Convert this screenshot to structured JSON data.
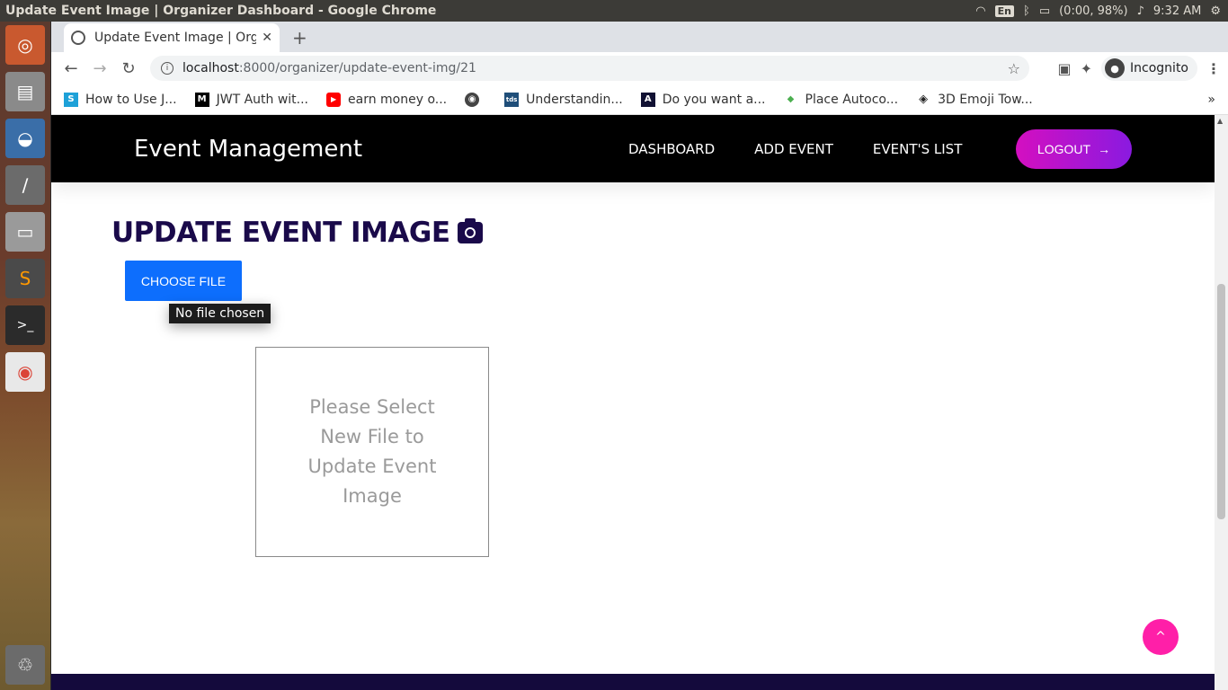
{
  "os": {
    "window_title": "Update Event Image | Organizer Dashboard - Google Chrome",
    "lang": "En",
    "battery": "(0:00, 98%)",
    "time": "9:32 AM"
  },
  "browser": {
    "tab_title": "Update Event Image | Organizer Dashboard",
    "url_host": "localhost",
    "url_path": ":8000/organizer/update-event-img/21",
    "incognito_label": "Incognito",
    "bookmarks": [
      {
        "label": "How to Use J...",
        "icon_color": "#1ea1d8",
        "icon_text": "S"
      },
      {
        "label": "JWT Auth wit...",
        "icon_color": "#000000",
        "icon_text": "M"
      },
      {
        "label": "earn money o...",
        "icon_color": "#ff0000",
        "icon_text": "▶"
      },
      {
        "label": "",
        "icon_color": "#444444",
        "icon_text": "◉"
      },
      {
        "label": "Understandin...",
        "icon_color": "#1f4e79",
        "icon_text": "tds"
      },
      {
        "label": "Do you want a...",
        "icon_color": "#111133",
        "icon_text": "A"
      },
      {
        "label": "Place Autoco...",
        "icon_color": "#4caf50",
        "icon_text": "◆"
      },
      {
        "label": "3D Emoji Tow...",
        "icon_color": "#222222",
        "icon_text": "◈"
      }
    ],
    "more_bookmarks": "»"
  },
  "site": {
    "brand": "Event Management",
    "nav": {
      "dashboard": "DASHBOARD",
      "add_event": "ADD EVENT",
      "events_list": "EVENT'S LIST"
    },
    "logout_label": "LOGOUT",
    "logout_arrow": "→"
  },
  "main": {
    "heading": "UPDATE EVENT IMAGE",
    "choose_file_label": "CHOOSE FILE",
    "file_tooltip": "No file chosen",
    "preview_placeholder": "Please Select New File to Update Event Image"
  },
  "colors": {
    "header_bg": "#000000",
    "heading_color": "#1a0a4a",
    "choose_file_bg": "#0d6efd",
    "logout_gradient_start": "#d40fc0",
    "logout_gradient_end": "#8a1ae0",
    "to_top_bg": "#ff1fa8",
    "footer_bg": "#140a3c"
  },
  "scroll_to_top_glyph": "^"
}
